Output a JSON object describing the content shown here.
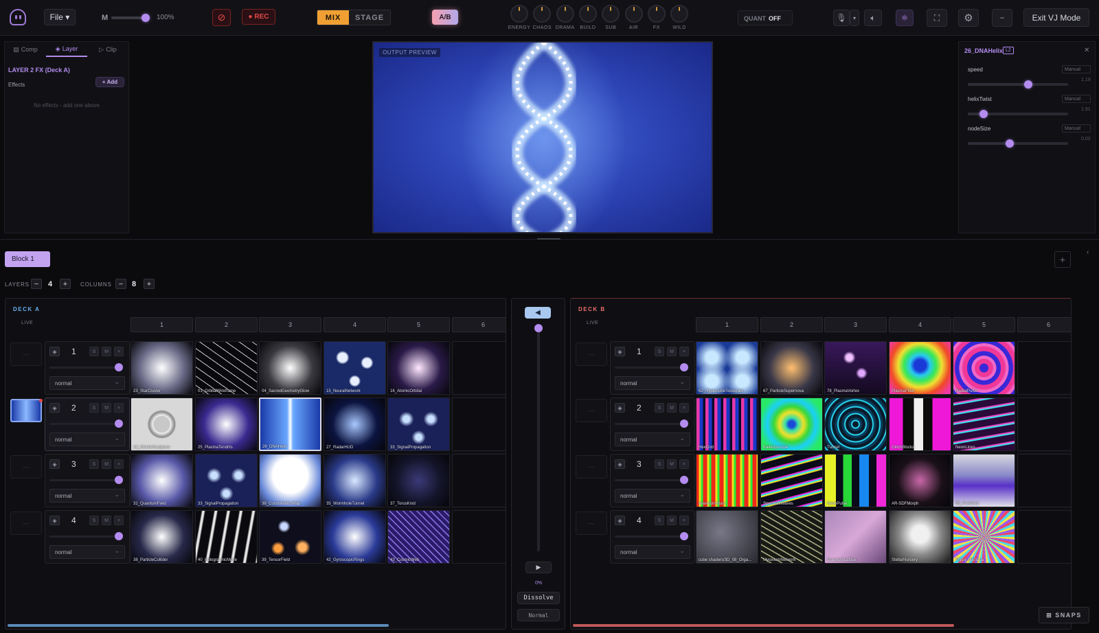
{
  "topbar": {
    "file_label": "File ▾",
    "master_label": "M",
    "master_value": "100%",
    "master_level": 1.0,
    "rec_label": "● REC",
    "mode_mix": "MIX",
    "mode_stage": "STAGE",
    "ab_label": "A/B",
    "knobs": [
      "ENERGY",
      "CHAOS",
      "DRAMA",
      "BUILD",
      "SUB",
      "AIR",
      "FX",
      "WILD"
    ],
    "quant_label": "QUANT",
    "quant_value": "OFF",
    "exit_label": "Exit VJ Mode",
    "icons": [
      "mic-icon",
      "chevron-down-icon",
      "speaker-icon",
      "atom-icon",
      "fullscreen-icon",
      "gear-icon",
      "minimize-icon"
    ]
  },
  "left_panel": {
    "tabs": [
      "Comp",
      "Layer",
      "Clip"
    ],
    "active_tab": "Layer",
    "heading": "LAYER 2 FX (Deck A)",
    "effects_label": "Effects",
    "add_label": "+ Add",
    "empty_text": "No effects - add one above"
  },
  "preview": {
    "tag": "OUTPUT PREVIEW"
  },
  "right_panel": {
    "title": "26_DNAHelix",
    "badge": "L2",
    "params": [
      {
        "name": "speed",
        "mode": "Manual",
        "value": "1.19",
        "level": 0.6
      },
      {
        "name": "helixTwist",
        "mode": "Manual",
        "value": "1.91",
        "level": 0.16
      },
      {
        "name": "nodeSize",
        "mode": "Manual",
        "value": "0.02",
        "level": 0.42
      }
    ]
  },
  "workspace": {
    "block_label": "Block 1",
    "layers_label": "LAYERS",
    "layers_count": "4",
    "columns_label": "COLUMNS",
    "columns_count": "8"
  },
  "deck_a": {
    "name": "DECK A",
    "live_label": "LIVE",
    "columns": [
      "1",
      "2",
      "3",
      "4",
      "5",
      "6"
    ],
    "layers": [
      {
        "num": "1",
        "blend": "normal",
        "clips": [
          "23_StarCluster",
          "01_OrbitalWireframe",
          "04_SacredGeometryGlow",
          "15_NeuralNetwork",
          "16_AtomicOrbital"
        ]
      },
      {
        "num": "2",
        "blend": "normal",
        "clips": [
          "24_KineticSculpture",
          "25_PlasmaTendrils",
          "26_DNAHelix",
          "27_RadarHUD",
          "33_SignalPropagation"
        ]
      },
      {
        "num": "3",
        "blend": "normal",
        "clips": [
          "31_QuantumField",
          "33_SignalPropagation",
          "36_ConstellationMap",
          "35_WormholeTunnel",
          "37_TorusKnot"
        ]
      },
      {
        "num": "4",
        "blend": "normal",
        "clips": [
          "38_ParticleCollider",
          "40_HolographicMoire",
          "39_TensorField",
          "42_GyroscopicRings",
          "43_CosmicWeb"
        ]
      }
    ]
  },
  "deck_b": {
    "name": "DECK B",
    "live_label": "LIVE",
    "columns": [
      "1",
      "2",
      "3",
      "4",
      "5",
      "6"
    ],
    "layers": [
      {
        "num": "1",
        "blend": "normal",
        "clips": [
          "62_HypercubeTesseract",
          "67_ParticleSupernova",
          "78_PlasmaVortex",
          "PlasmaFlow",
          "RadialPulse"
        ]
      },
      {
        "num": "2",
        "blend": "normal",
        "clips": [
          "HexGrid",
          "Kaleidoscope",
          "Tunnel",
          "GlitchBlocks",
          "NeonLines"
        ]
      },
      {
        "num": "3",
        "blend": "normal",
        "clips": [
          "WaveformBars",
          "SpectrumWaves",
          "NeonPulse",
          "AR-SDFMorph",
          "95_PixelSort"
        ]
      },
      {
        "num": "4",
        "blend": "normal",
        "clips": [
          "cube shaders/3D_08_Orga...",
          "MyceliumNetwork",
          "QuantumLattice",
          "StellarNursery",
          "Trippy Mandala"
        ]
      }
    ]
  },
  "crossfader": {
    "value": "0%",
    "level": 0.0,
    "transition": "Dissolve",
    "blend": "Normal"
  },
  "snaps_label": "SNAPS",
  "colors": {
    "accent": "#b48cf0",
    "mix": "#f0a032",
    "rec": "#e04848",
    "deck_a": "#6ab0f0",
    "deck_b": "#f07070"
  }
}
